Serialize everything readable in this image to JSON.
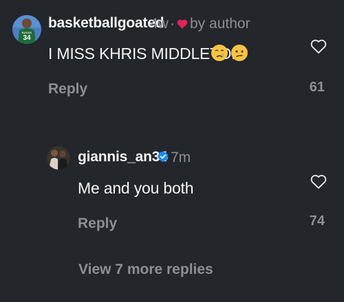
{
  "comments": [
    {
      "username": "basketballgoated",
      "time": "4w",
      "separator": "·",
      "author_badge": "by author",
      "text": "I MISS KHRIS MIDDLETON",
      "emojis": [
        "crying-face",
        "confused-face"
      ],
      "reply_label": "Reply",
      "likes": "61",
      "avatar_jersey_number": "34",
      "avatar_jersey_text": "BUCKS"
    },
    {
      "username": "giannis_an34",
      "time": "7m",
      "verified": true,
      "text": "Me and you both",
      "reply_label": "Reply",
      "likes": "74"
    }
  ],
  "view_more_label": "View 7 more replies",
  "colors": {
    "background": "#23262b",
    "text_primary": "#f4f5f7",
    "text_secondary": "#8b9096",
    "author_heart": "#e0245e",
    "verified_blue": "#1d8cf0",
    "jersey_green": "#1f6b3a"
  }
}
